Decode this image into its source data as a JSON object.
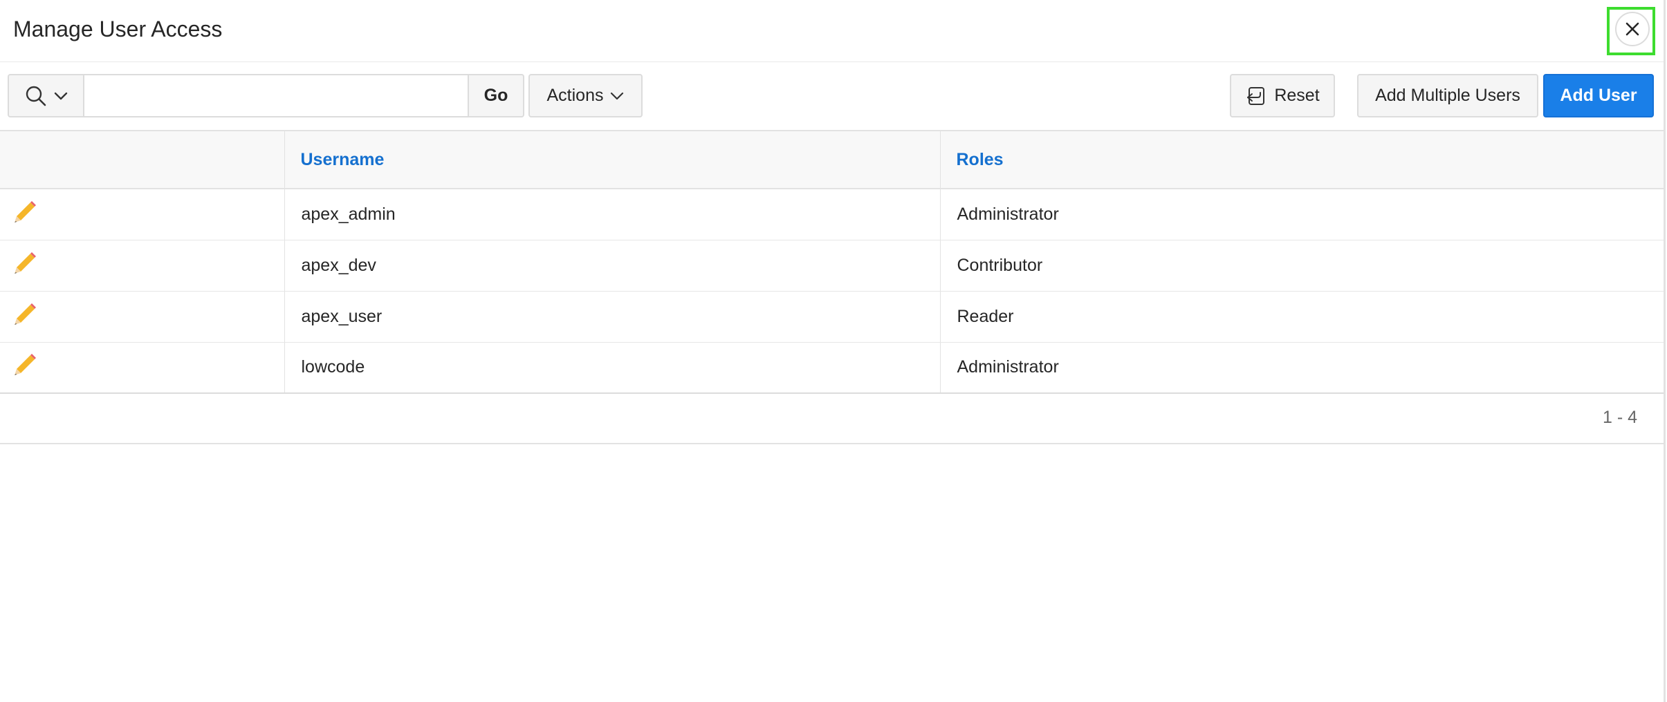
{
  "dialog": {
    "title": "Manage User Access",
    "close_icon": "close-icon"
  },
  "toolbar": {
    "search_columns_icon": "search-icon",
    "search_placeholder": "",
    "search_value": "",
    "go_label": "Go",
    "actions_label": "Actions",
    "reset_label": "Reset",
    "add_multiple_label": "Add Multiple Users",
    "add_user_label": "Add User"
  },
  "table": {
    "columns": [
      "",
      "Username",
      "Roles"
    ],
    "rows": [
      {
        "username": "apex_admin",
        "role": "Administrator",
        "edit_icon": "pencil-icon"
      },
      {
        "username": "apex_dev",
        "role": "Contributor",
        "edit_icon": "pencil-icon"
      },
      {
        "username": "apex_user",
        "role": "Reader",
        "edit_icon": "pencil-icon"
      },
      {
        "username": "lowcode",
        "role": "Administrator",
        "edit_icon": "pencil-icon"
      }
    ]
  },
  "pagination": {
    "range": "1 - 4"
  },
  "colors": {
    "primary": "#1a7fe8",
    "header_link": "#1570cf",
    "highlight": "#3ddc2f"
  }
}
